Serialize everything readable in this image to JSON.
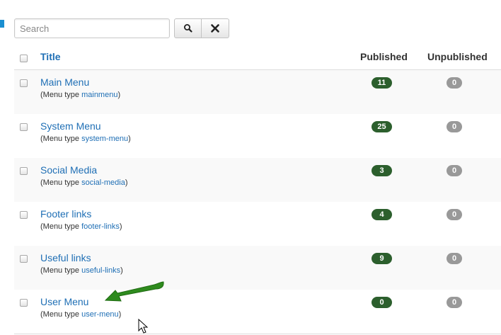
{
  "search": {
    "placeholder": "Search",
    "value": ""
  },
  "toolbar": {
    "search_icon": "search-icon",
    "clear_icon": "close-icon"
  },
  "table": {
    "headers": {
      "title": "Title",
      "published": "Published",
      "unpublished": "Unpublished"
    },
    "menu_type_prefix": "(Menu type ",
    "menu_type_suffix": ")",
    "rows": [
      {
        "title": "Main Menu",
        "menu_type": "mainmenu",
        "published": "11",
        "unpublished": "0"
      },
      {
        "title": "System Menu",
        "menu_type": "system-menu",
        "published": "25",
        "unpublished": "0"
      },
      {
        "title": "Social Media",
        "menu_type": "social-media",
        "published": "3",
        "unpublished": "0"
      },
      {
        "title": "Footer links",
        "menu_type": "footer-links",
        "published": "4",
        "unpublished": "0"
      },
      {
        "title": "Useful links",
        "menu_type": "useful-links",
        "published": "9",
        "unpublished": "0"
      },
      {
        "title": "User Menu",
        "menu_type": "user-menu",
        "published": "0",
        "unpublished": "0"
      }
    ]
  },
  "colors": {
    "link": "#1f6fb5",
    "published_badge": "#2c5f2d",
    "unpublished_badge": "#999999",
    "accent": "#1a8fd1",
    "annotation_arrow": "#2e8b1e"
  },
  "annotation": {
    "icon": "arrow-icon",
    "target": "User Menu"
  },
  "cursor": {
    "icon": "mouse-cursor-icon"
  }
}
